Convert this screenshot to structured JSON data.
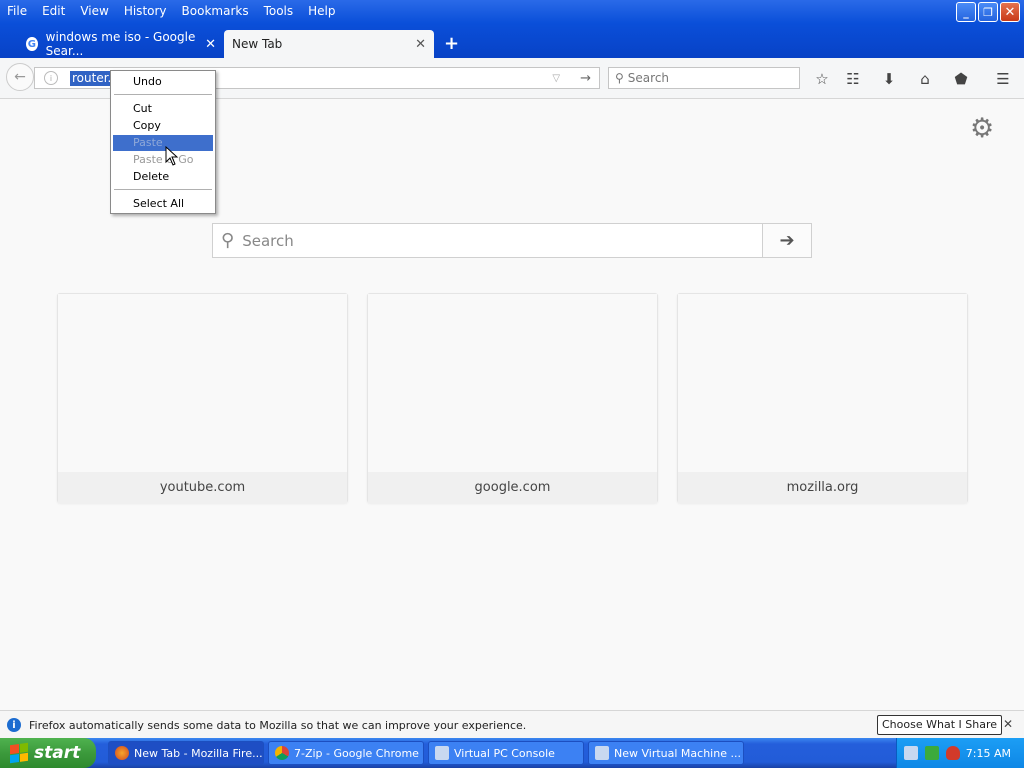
{
  "menubar": {
    "items": [
      "File",
      "Edit",
      "View",
      "History",
      "Bookmarks",
      "Tools",
      "Help"
    ]
  },
  "window_controls": {
    "minimize": "_",
    "restore": "❐",
    "close": "✕"
  },
  "tabs": [
    {
      "title": "windows me iso - Google Sear...",
      "close": "✕"
    },
    {
      "title": "New Tab",
      "close": "✕"
    }
  ],
  "newtab_plus": "+",
  "navbar": {
    "url_text": "router.co",
    "search_placeholder": "Search"
  },
  "context_menu": {
    "items": [
      "Undo",
      "Cut",
      "Copy",
      "Paste",
      "Paste & Go",
      "Delete",
      "Select All"
    ],
    "hovered": "Paste"
  },
  "newtab_page": {
    "search_placeholder": "Search",
    "tiles": [
      "youtube.com",
      "google.com",
      "mozilla.org"
    ]
  },
  "notification": {
    "message": "Firefox automatically sends some data to Mozilla so that we can improve your experience.",
    "button": "Choose What I Share",
    "close": "✕"
  },
  "taskbar": {
    "start_label": "start",
    "tasks": [
      "New Tab - Mozilla Fire...",
      "7-Zip - Google Chrome",
      "Virtual PC Console",
      "New Virtual Machine ..."
    ],
    "clock": "7:15 AM"
  }
}
